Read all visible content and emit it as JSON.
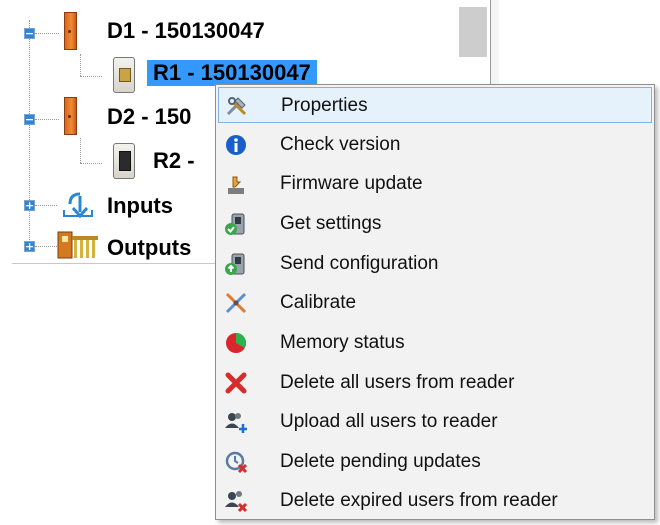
{
  "tree": {
    "nodes": [
      {
        "label": "D1 - 150130047",
        "expander": "−"
      },
      {
        "label": "R1 - 150130047"
      },
      {
        "label": "D2 - 150",
        "expander": "−"
      },
      {
        "label": "R2 -"
      },
      {
        "label": "Inputs",
        "expander": "+"
      },
      {
        "label": "Outputs",
        "expander": "+"
      }
    ]
  },
  "menu": {
    "items": [
      {
        "label": "Properties",
        "icon": "tools-icon"
      },
      {
        "label": "Check version",
        "icon": "info-icon"
      },
      {
        "label": "Firmware update",
        "icon": "firmware-icon"
      },
      {
        "label": "Get settings",
        "icon": "get-settings-icon"
      },
      {
        "label": "Send configuration",
        "icon": "send-config-icon"
      },
      {
        "label": "Calibrate",
        "icon": "calibrate-icon"
      },
      {
        "label": "Memory status",
        "icon": "memory-pie-icon"
      },
      {
        "label": "Delete all users from reader",
        "icon": "delete-x-icon"
      },
      {
        "label": "Upload all users to reader",
        "icon": "users-upload-icon"
      },
      {
        "label": "Delete pending updates",
        "icon": "delete-pending-icon"
      },
      {
        "label": "Delete expired users from reader",
        "icon": "delete-expired-users-icon"
      }
    ]
  },
  "colors": {
    "selection": "#3399ff",
    "menu_hover": "#e5f1fb",
    "menu_hover_border": "#7eb4ea",
    "menu_bg": "#f2f2f2"
  }
}
